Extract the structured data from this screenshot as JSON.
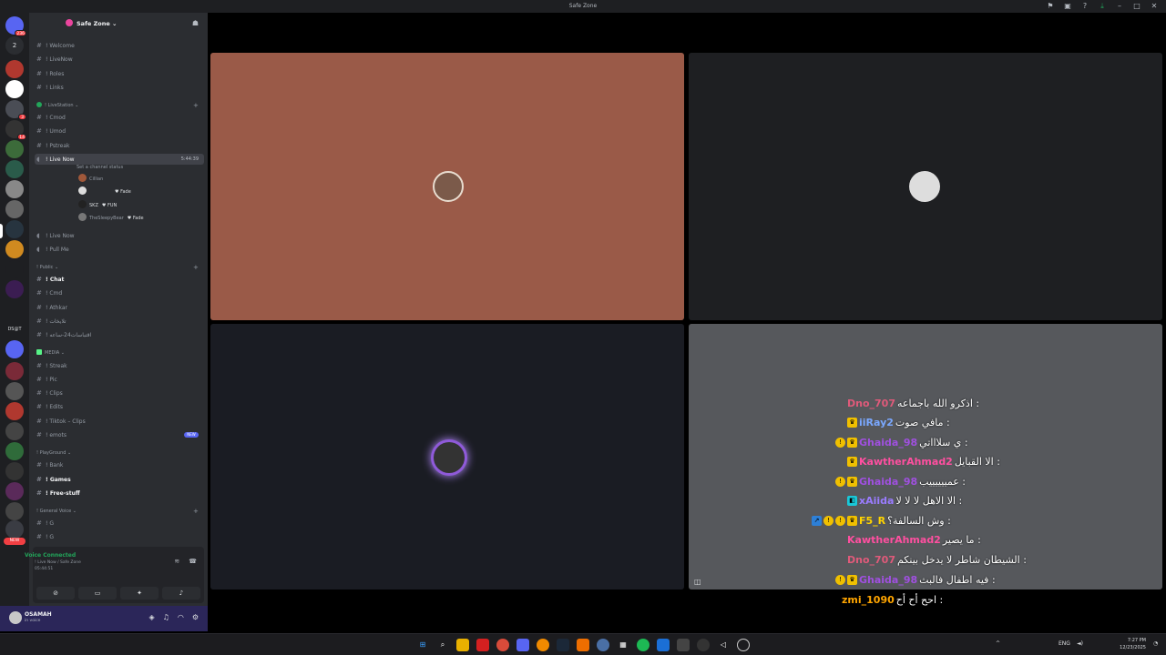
{
  "window": {
    "title": "Safe Zone"
  },
  "server": {
    "name": "Safe Zone ⌄"
  },
  "rail": {
    "badges": [
      "236",
      "2",
      "",
      "",
      "",
      "",
      "3",
      "",
      "14",
      "",
      "",
      "",
      "",
      "",
      "",
      "",
      "",
      "",
      "",
      "",
      "",
      "",
      "",
      "",
      "",
      "",
      "",
      "",
      "",
      "",
      "",
      "",
      ""
    ],
    "labels": {
      "dm_count": "2",
      "bot_label": "DS@T",
      "new": "NEW"
    }
  },
  "channels": {
    "top": [
      {
        "label": "! Welcome"
      },
      {
        "label": "! LiveNow"
      },
      {
        "label": "! Roles"
      },
      {
        "label": "! Links"
      }
    ],
    "livestation": {
      "header": "! LiveStation ⌄",
      "items": [
        {
          "label": "! Cmod"
        },
        {
          "label": "! Umod"
        },
        {
          "label": "! Pstreak"
        }
      ],
      "live_now": {
        "label": "! Live Now",
        "time": "5:44:39",
        "status": "Set a channel status"
      },
      "voice_users": [
        {
          "name": "Cillian",
          "tag": ""
        },
        {
          "name": "",
          "tag": "♥ Fade"
        },
        {
          "name": "SKZ",
          "tag": "♥ FUN"
        },
        {
          "name": "TheSleepyBear",
          "tag": "♥ Fade"
        }
      ],
      "after": [
        {
          "label": "! Live Now"
        },
        {
          "label": "! Pull Me"
        }
      ]
    },
    "public": {
      "header": "! Public ⌄",
      "items": [
        {
          "label": "! Chat"
        },
        {
          "label": "! Cmd"
        },
        {
          "label": "! Athkar"
        },
        {
          "label": "! تلايخات"
        },
        {
          "label": "! اقتباسات24-ساعه"
        }
      ]
    },
    "media": {
      "header": "MEDIA ⌄",
      "items": [
        {
          "label": "! Streak"
        },
        {
          "label": "! Pic"
        },
        {
          "label": "! Clips"
        },
        {
          "label": "! Edits"
        },
        {
          "label": "! Tiktok – Clips"
        },
        {
          "label": "! emots",
          "badge": "NEW"
        }
      ]
    },
    "playground": {
      "header": "! PlayGround ⌄",
      "items": [
        {
          "label": "! Bank"
        },
        {
          "label": "! Games"
        },
        {
          "label": "! Free-stuff"
        }
      ]
    },
    "general_voice": {
      "header": "! General Voice ⌄",
      "items": [
        {
          "label": "! G"
        },
        {
          "label": "! G"
        }
      ]
    }
  },
  "voice_panel": {
    "status": "Voice Connected",
    "location": "! Live Now / Safe Zone",
    "elapsed": "05:44:51"
  },
  "user": {
    "name": "OSAMAH",
    "status": "in voice"
  },
  "chat": [
    {
      "user": "Dno_707",
      "color": "#e05a7a",
      "msg": "اذكرو الله باجماعه :",
      "badges": []
    },
    {
      "user": "iiRay2",
      "color": "#7aa8ff",
      "msg": "مافي صوت :",
      "badges": [
        "crown"
      ]
    },
    {
      "user": "Ghaida_98",
      "color": "#a050e0",
      "msg": "ي سلاااتي :",
      "badges": [
        "sub",
        "crown"
      ]
    },
    {
      "user": "KawtherAhmad2",
      "color": "#ff4fa0",
      "msg": "الا القبايل :",
      "badges": [
        "crown"
      ]
    },
    {
      "user": "Ghaida_98",
      "color": "#a050e0",
      "msg": "عمييييييب :",
      "badges": [
        "sub",
        "crown"
      ]
    },
    {
      "user": "xAiida",
      "color": "#9a7cff",
      "msg": "الا الاهل لا لا لا :",
      "badges": [
        "cyan"
      ]
    },
    {
      "user": "F5_R",
      "color": "#ffd400",
      "msg": "وش السالفة؟ :",
      "badges": [
        "blue",
        "sub",
        "sub",
        "crown"
      ]
    },
    {
      "user": "KawtherAhmad2",
      "color": "#ff4fa0",
      "msg": "ما يصير :",
      "badges": []
    },
    {
      "user": "Dno_707",
      "color": "#e05a7a",
      "msg": "الشيطان شاطر لا يدخل بينكم :",
      "badges": []
    },
    {
      "user": "Ghaida_98",
      "color": "#a050e0",
      "msg": "فيه اطفال فالبث :",
      "badges": [
        "sub",
        "crown"
      ]
    },
    {
      "user": "zmi_1090",
      "color": "#ffa500",
      "msg": "احح أح أح :",
      "badges": []
    }
  ],
  "taskbar": {
    "lang": "ENG",
    "time": "7:27 PM",
    "date": "12/23/2025"
  },
  "colors": {
    "accent": "#5865f2",
    "online": "#23a55a",
    "tile1": "#9a5a48",
    "tile2": "#1e1f22",
    "tile3": "#1a1c23",
    "tile4": "#56585c"
  },
  "icons": [
    "search-icon",
    "gear-icon",
    "mic-icon",
    "headphones-icon",
    "hash-icon",
    "speaker-icon",
    "plus-icon"
  ]
}
